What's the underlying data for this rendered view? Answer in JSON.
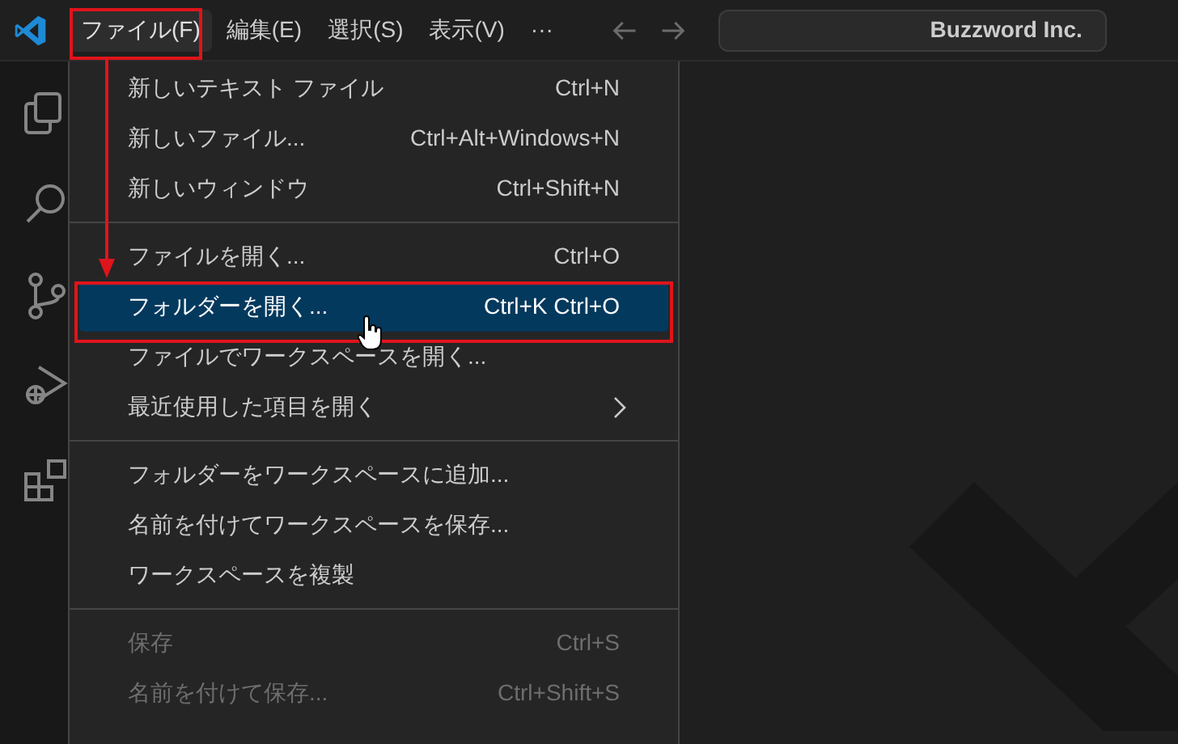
{
  "menubar": [
    {
      "label": "ファイル(F)",
      "selected": true
    },
    {
      "label": "編集(E)",
      "selected": false
    },
    {
      "label": "選択(S)",
      "selected": false
    },
    {
      "label": "表示(V)",
      "selected": false
    },
    {
      "label": "···",
      "selected": false
    }
  ],
  "command_center": {
    "value": "Buzzword Inc."
  },
  "menu": [
    {
      "kind": "item",
      "label": "新しいテキスト ファイル",
      "shortcut": "Ctrl+N",
      "selected": false,
      "disabled": false
    },
    {
      "kind": "item",
      "label": "新しいファイル...",
      "shortcut": "Ctrl+Alt+Windows+N",
      "selected": false,
      "disabled": false
    },
    {
      "kind": "item",
      "label": "新しいウィンドウ",
      "shortcut": "Ctrl+Shift+N",
      "selected": false,
      "disabled": false
    },
    {
      "kind": "separator"
    },
    {
      "kind": "item",
      "label": "ファイルを開く...",
      "shortcut": "Ctrl+O",
      "selected": false,
      "disabled": false
    },
    {
      "kind": "item",
      "label": "フォルダーを開く...",
      "shortcut": "Ctrl+K Ctrl+O",
      "selected": true,
      "disabled": false
    },
    {
      "kind": "item",
      "label": "ファイルでワークスペースを開く...",
      "selected": false,
      "disabled": false
    },
    {
      "kind": "submenu",
      "label": "最近使用した項目を開く",
      "selected": false,
      "disabled": false
    },
    {
      "kind": "separator"
    },
    {
      "kind": "item",
      "label": "フォルダーをワークスペースに追加...",
      "selected": false,
      "disabled": false
    },
    {
      "kind": "item",
      "label": "名前を付けてワークスペースを保存...",
      "selected": false,
      "disabled": false
    },
    {
      "kind": "item",
      "label": "ワークスペースを複製",
      "selected": false,
      "disabled": false
    },
    {
      "kind": "separator"
    },
    {
      "kind": "item",
      "label": "保存",
      "shortcut": "Ctrl+S",
      "selected": false,
      "disabled": true
    },
    {
      "kind": "item",
      "label": "名前を付けて保存...",
      "shortcut": "Ctrl+Shift+S",
      "selected": false,
      "disabled": true
    }
  ]
}
